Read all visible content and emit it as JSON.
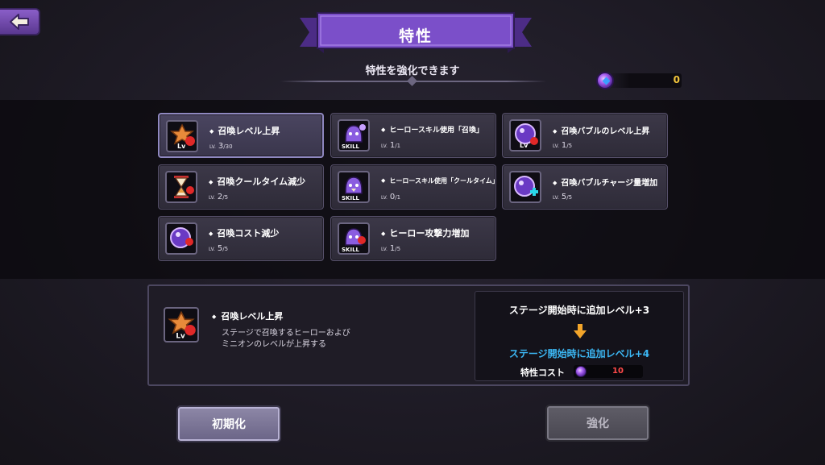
{
  "header": {
    "title": "特性",
    "subtitle": "特性を強化できます"
  },
  "currency": {
    "value": "0"
  },
  "traits": [
    {
      "name": "召喚レベル上昇",
      "lv_tag": "LV.",
      "level": "3",
      "max": "/30",
      "icon": "summon-level-icon",
      "selected": true
    },
    {
      "name": "ヒーロースキル使用「召喚」",
      "lv_tag": "LV.",
      "level": "1",
      "max": "/1",
      "icon": "skill-summon-icon"
    },
    {
      "name": "召喚バブルのレベル上昇",
      "lv_tag": "LV.",
      "level": "1",
      "max": "/5",
      "icon": "bubble-level-icon"
    },
    {
      "name": "召喚クールタイム減少",
      "lv_tag": "LV.",
      "level": "2",
      "max": "/5",
      "icon": "hourglass-icon"
    },
    {
      "name": "ヒーロースキル使用「クールタイム」",
      "lv_tag": "LV.",
      "level": "0",
      "max": "/1",
      "icon": "skill-cooldown-icon"
    },
    {
      "name": "召喚バブルチャージ量増加",
      "lv_tag": "LV.",
      "level": "5",
      "max": "/5",
      "icon": "bubble-charge-icon"
    },
    {
      "name": "召喚コスト減少",
      "lv_tag": "LV.",
      "level": "5",
      "max": "/5",
      "icon": "cost-down-icon"
    },
    {
      "name": "ヒーロー攻撃力増加",
      "lv_tag": "LV.",
      "level": "1",
      "max": "/5",
      "icon": "skill-attack-icon"
    }
  ],
  "detail": {
    "name": "召喚レベル上昇",
    "description_line1": "ステージで召喚するヒーローおよび",
    "description_line2": "ミニオンのレベルが上昇する",
    "current_effect": "ステージ開始時に追加レベル+3",
    "next_effect": "ステージ開始時に追加レベル+4",
    "cost_label": "特性コスト",
    "cost_value": "10"
  },
  "buttons": {
    "reset": "初期化",
    "upgrade": "強化"
  },
  "colors": {
    "banner": "#7b4fc9",
    "accent_blue": "#3cb8f5",
    "cost_red": "#ff4a4a",
    "gold": "#f3c63c"
  }
}
